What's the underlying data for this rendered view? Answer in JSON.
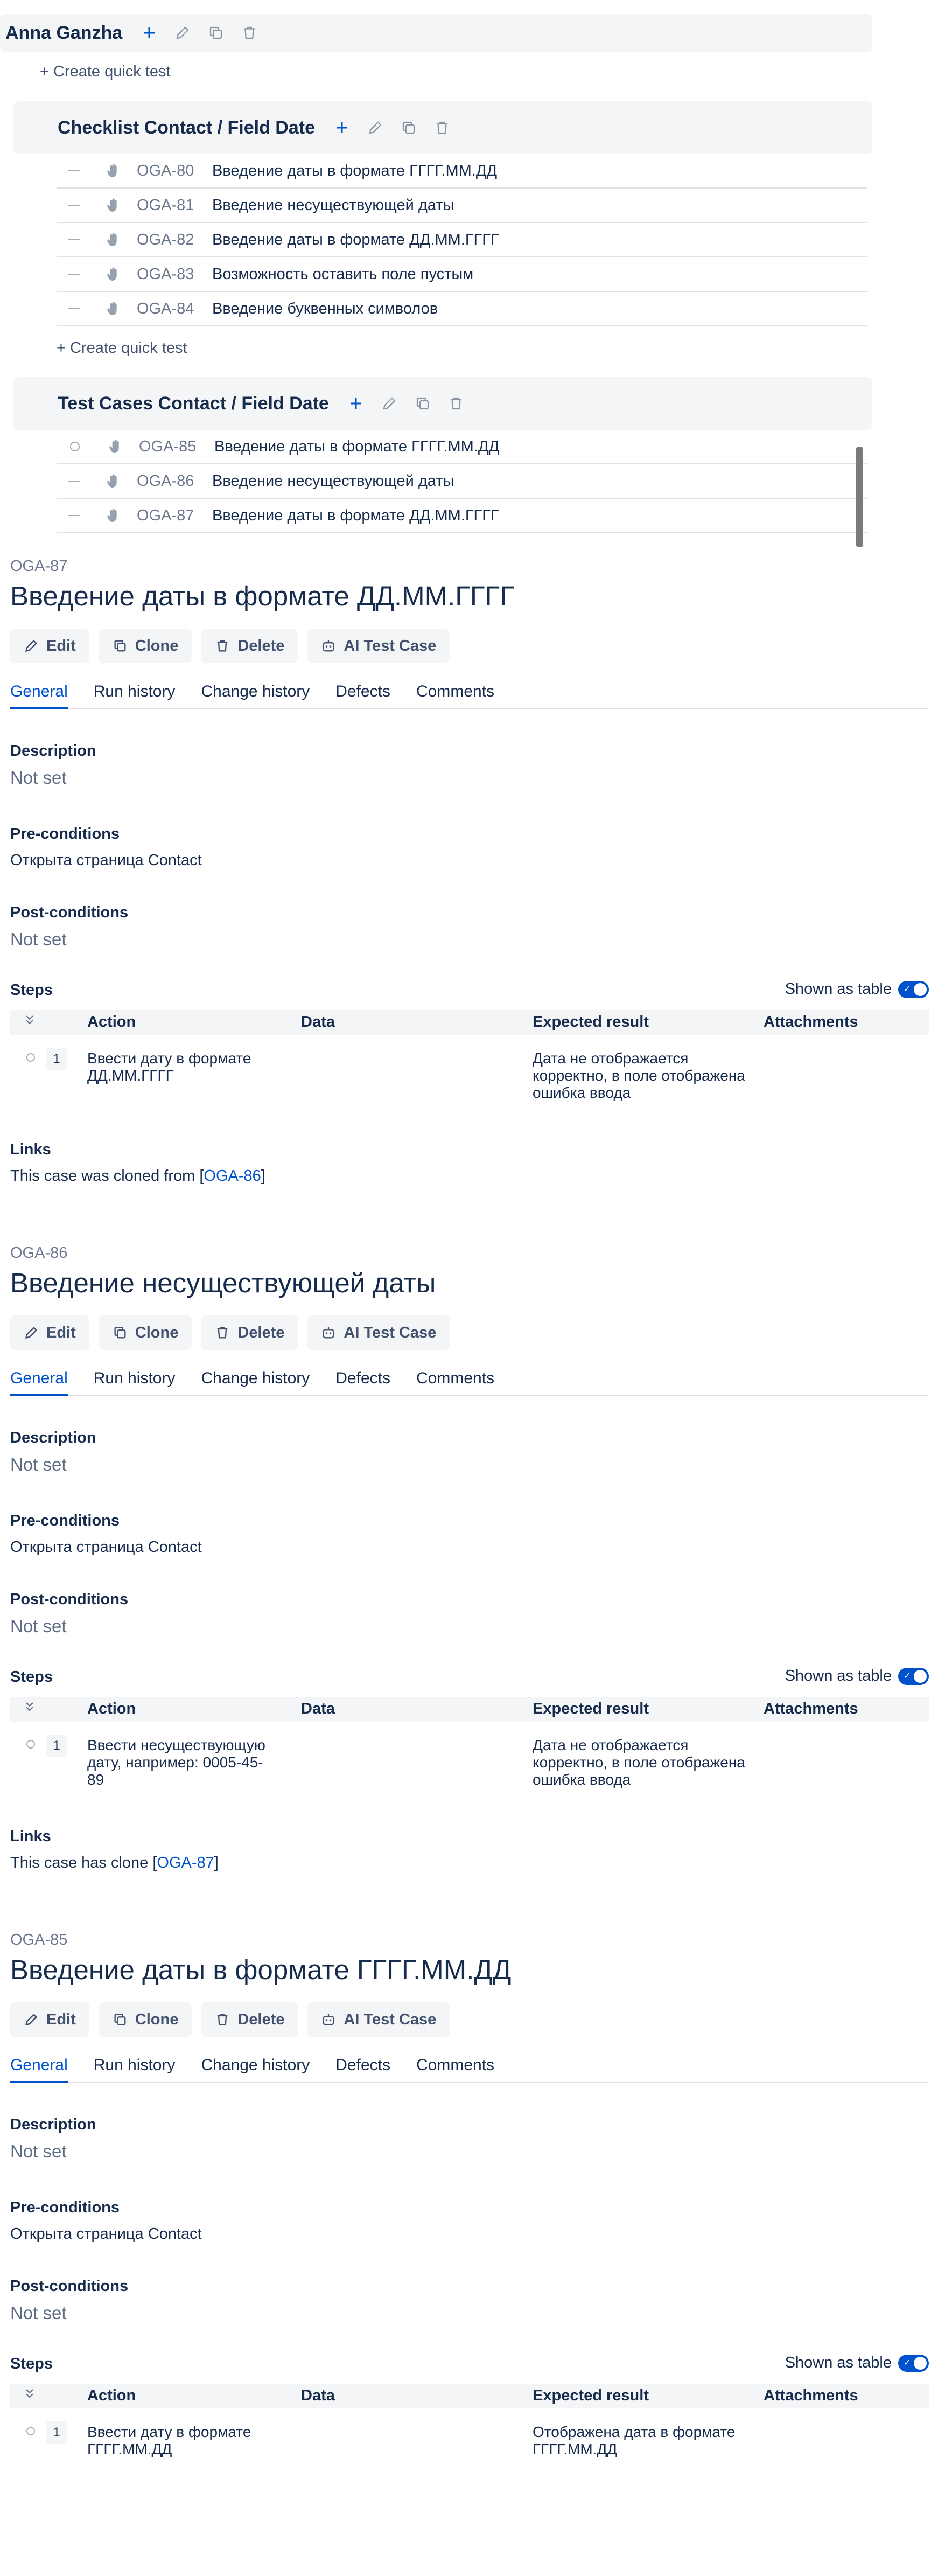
{
  "tree": {
    "root_suite": {
      "title": "Anna Ganzha"
    },
    "quick_test_label": "+ Create quick test",
    "suites": [
      {
        "title": "Checklist Contact / Field Date",
        "cases": [
          {
            "id": "OGA-80",
            "title": "Введение даты в формате ГГГГ.ММ.ДД",
            "status": "dash"
          },
          {
            "id": "OGA-81",
            "title": "Введение несуществующей даты",
            "status": "dash"
          },
          {
            "id": "OGA-82",
            "title": "Введение даты в формате ДД.ММ.ГГГГ",
            "status": "dash"
          },
          {
            "id": "OGA-83",
            "title": "Возможность оставить поле пустым",
            "status": "dash"
          },
          {
            "id": "OGA-84",
            "title": "Введение буквенных символов",
            "status": "dash"
          }
        ]
      },
      {
        "title": "Test Cases Contact / Field Date",
        "cases": [
          {
            "id": "OGA-85",
            "title": "Введение даты в формате ГГГГ.ММ.ДД",
            "status": "circle"
          },
          {
            "id": "OGA-86",
            "title": "Введение несуществующей даты",
            "status": "dash"
          },
          {
            "id": "OGA-87",
            "title": "Введение даты в формате ДД.ММ.ГГГГ",
            "status": "dash"
          }
        ]
      }
    ]
  },
  "labels": {
    "edit": "Edit",
    "clone": "Clone",
    "delete": "Delete",
    "ai": "AI Test Case",
    "tabs": [
      "General",
      "Run history",
      "Change history",
      "Defects",
      "Comments"
    ],
    "description": "Description",
    "preconditions": "Pre-conditions",
    "postconditions": "Post-conditions",
    "steps": "Steps",
    "shown_as_table": "Shown as table",
    "col_action": "Action",
    "col_data": "Data",
    "col_expected": "Expected result",
    "col_attachments": "Attachments",
    "links": "Links",
    "not_set": "Not set"
  },
  "details": [
    {
      "key": "OGA-87",
      "title": "Введение даты в формате ДД.ММ.ГГГГ",
      "description": "Not set",
      "preconditions": "Открыта страница Contact",
      "postconditions": "Not set",
      "step": {
        "num": "1",
        "action": "Ввести дату в формате ДД.ММ.ГГГГ",
        "expected": "Дата не отображается корректно, в поле отображена ошибка ввода"
      },
      "links": {
        "prefix": "This case was cloned from [",
        "link": "OGA-86",
        "suffix": "]"
      }
    },
    {
      "key": "OGA-86",
      "title": "Введение несуществующей даты",
      "description": "Not set",
      "preconditions": "Открыта страница Contact",
      "postconditions": "Not set",
      "step": {
        "num": "1",
        "action": "Ввести несуществующую дату, например: 0005-45-89",
        "expected": "Дата не отображается корректно, в поле отображена ошибка ввода"
      },
      "links": {
        "prefix": "This case has clone [",
        "link": "OGA-87",
        "suffix": "]"
      }
    },
    {
      "key": "OGA-85",
      "title": "Введение даты в формате ГГГГ.ММ.ДД",
      "description": "Not set",
      "preconditions": "Открыта страница Contact",
      "postconditions": "Not set",
      "step": {
        "num": "1",
        "action": "Ввести дату в формате ГГГГ.ММ.ДД",
        "expected": "Отображена дата в формате ГГГГ.ММ.ДД"
      }
    }
  ],
  "colors": {
    "accent": "#0052cc",
    "text": "#172b4d",
    "muted": "#6b778c",
    "panel": "#f4f5f7"
  }
}
